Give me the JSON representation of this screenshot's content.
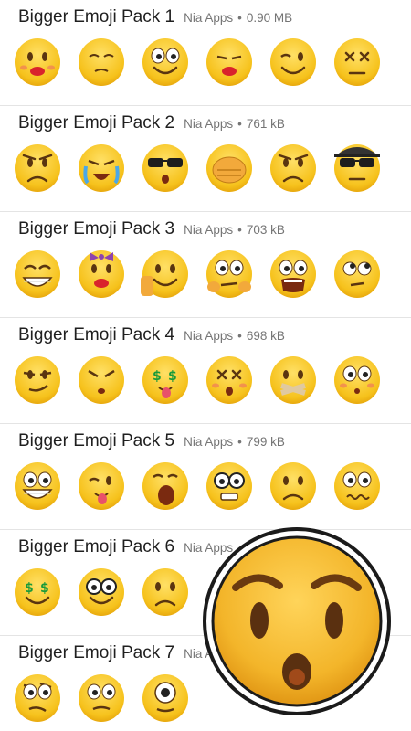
{
  "packs": [
    {
      "title": "Bigger Emoji Pack 1",
      "publisher": "Nia Apps",
      "size": "0.90 MB",
      "stickers": [
        "kissy-face-icon",
        "dizzy-face-icon",
        "smiling-face-icon",
        "lipstick-kiss-icon",
        "winking-face-icon",
        "knocked-out-face-icon"
      ]
    },
    {
      "title": "Bigger Emoji Pack 2",
      "publisher": "Nia Apps",
      "size": "761 kB",
      "stickers": [
        "frustrated-face-icon",
        "crying-face-icon",
        "sunglasses-face-icon",
        "facepalm-face-icon",
        "angry-face-icon",
        "hat-sunglasses-face-icon"
      ]
    },
    {
      "title": "Bigger Emoji Pack 3",
      "publisher": "Nia Apps",
      "size": "703 kB",
      "stickers": [
        "grinning-face-icon",
        "bow-face-icon",
        "rock-hand-face-icon",
        "thinking-face-icon",
        "shocked-face-icon",
        "eye-roll-face-icon"
      ]
    },
    {
      "title": "Bigger Emoji Pack 4",
      "publisher": "Nia Apps",
      "size": "698 kB",
      "stickers": [
        "smirk-face-icon",
        "ghost-face-icon",
        "money-tongue-face-icon",
        "x-eyes-face-icon",
        "taped-mouth-face-icon",
        "blushing-face-icon"
      ]
    },
    {
      "title": "Bigger Emoji Pack 5",
      "publisher": "Nia Apps",
      "size": "799 kB",
      "stickers": [
        "grin-face-icon",
        "tongue-out-face-icon",
        "yawning-face-icon",
        "nerd-face-icon",
        "worried-face-icon",
        "wavy-mouth-face-icon"
      ]
    },
    {
      "title": "Bigger Emoji Pack 6",
      "publisher": "Nia Apps",
      "size": "",
      "stickers": [
        "money-eyes-face-icon",
        "glasses-face-icon",
        "frowning-face-icon"
      ]
    },
    {
      "title": "Bigger Emoji Pack 7",
      "publisher": "Nia Apps",
      "size": "",
      "stickers": [
        "skeptical-face-icon",
        "omg-face-icon",
        "cyclops-face-icon"
      ]
    }
  ],
  "overlay": {
    "emoji": "hushed-face-icon",
    "color": "#f2b82e"
  }
}
